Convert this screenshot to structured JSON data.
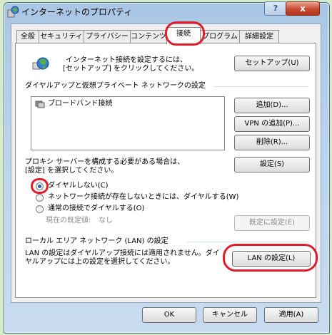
{
  "window": {
    "title": "インターネットのプロパティ",
    "help_label": "?",
    "close_label": "x"
  },
  "tabs": [
    "全般",
    "セキュリティ",
    "プライバシー",
    "コンテンツ",
    "接続",
    "プログラム",
    "詳細設定"
  ],
  "setup": {
    "description_line1": "インターネット接続を設定するには、",
    "description_line2": "[セットアップ] をクリックしてください。",
    "setup_button": "セットアップ(U)"
  },
  "dialup": {
    "group_title": "ダイヤルアップと仮想プライベート ネットワークの設定",
    "connections": [
      "ブロードバンド接続"
    ],
    "add_button": "追加(D)...",
    "add_vpn_button": "VPN の追加(P)...",
    "delete_button": "削除(R)...",
    "settings_button": "設定(S)",
    "proxy_text_line1": "プロキシ サーバーを構成する必要がある場合は、",
    "proxy_text_line2": "[設定] を選択してください。"
  },
  "dial_options": [
    {
      "label": "ダイヤルしない(C)",
      "selected": true
    },
    {
      "label": "ネットワーク接続が存在しないときには、ダイヤルする(W)",
      "selected": false
    },
    {
      "label": "通常の接続でダイヤルする(O)",
      "selected": false
    }
  ],
  "default_connection": {
    "label": "現在の既定値:",
    "value": "なし",
    "set_default_button": "既定に設定(E)"
  },
  "lan": {
    "group_title": "ローカル エリア ネットワーク (LAN) の設定",
    "description_line1": "LAN の設定はダイヤルアップ接続には適用されません。ダイ",
    "description_line2": "ヤルアップには上の設定を選択してください。",
    "lan_button": "LAN の設定(L)"
  },
  "footer": {
    "ok": "OK",
    "cancel": "キャンセル",
    "apply": "適用(A)"
  },
  "colors": {
    "highlight_ring": "#e21b2b",
    "background": "#d7ebc8"
  }
}
